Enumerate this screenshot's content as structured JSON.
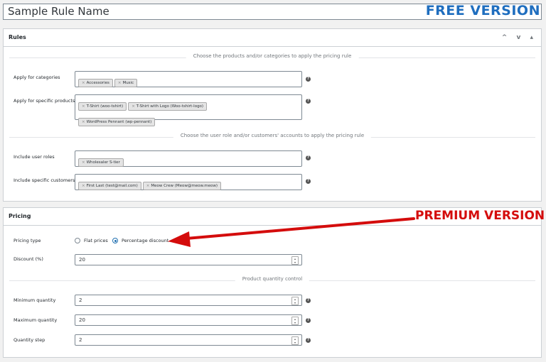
{
  "rule_name": "Sample Rule Name",
  "free_banner": "FREE VERSION",
  "premium_banner": "PREMIUM VERSION",
  "rules_panel": {
    "title": "Rules",
    "controls": "^ v ▴",
    "products_separator": "Choose the products and/or categories to apply the pricing rule",
    "users_separator": "Choose the user role and/or customers' accounts to apply the pricing rule",
    "categories": {
      "label": "Apply for categories",
      "tags": [
        "Accessories",
        "Music"
      ]
    },
    "products": {
      "label": "Apply for specific products",
      "tags": [
        "T-Shirt (woo-tshirt)",
        "T-Shirt with Logo (Woo-tshirt-logo)",
        "WordPress Pennant (wp-pennant)"
      ]
    },
    "roles": {
      "label": "Include user roles",
      "tags": [
        "Wholesaler S-tier"
      ]
    },
    "customers": {
      "label": "Include specific customers",
      "tags": [
        "First Last (test@mail.com)",
        "Meow Crew (Meow@meow.meow)"
      ]
    }
  },
  "pricing_panel": {
    "title": "Pricing",
    "pricing_type": {
      "label": "Pricing type",
      "options": [
        "Flat prices",
        "Percentage discount"
      ],
      "selected": "Percentage discount"
    },
    "discount": {
      "label": "Discount (%)",
      "value": "20"
    },
    "quantity_separator": "Product quantity control",
    "min_qty": {
      "label": "Minimum quantity",
      "value": "2"
    },
    "max_qty": {
      "label": "Maximum quantity",
      "value": "20"
    },
    "qty_step": {
      "label": "Quantity step",
      "value": "2"
    }
  },
  "colors": {
    "free_banner": "#1f6ebf",
    "premium_banner": "#d40c0c",
    "accent": "#2271b1"
  }
}
